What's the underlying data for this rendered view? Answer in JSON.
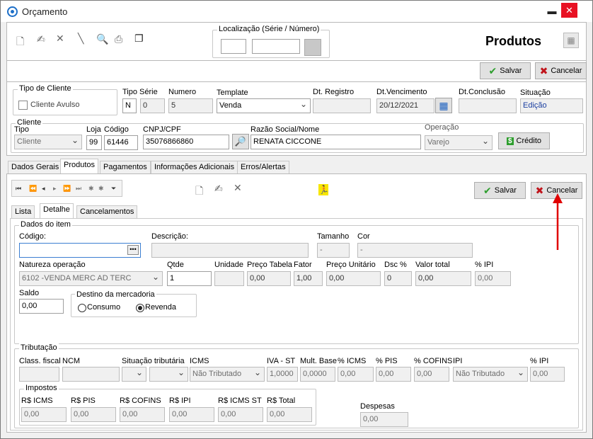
{
  "window": {
    "title": "Orçamento",
    "minimize": "▬",
    "maximize": "☐",
    "close": "✕"
  },
  "toolbar": {
    "localizacao_label": "Localização (Série / Número)",
    "section_title": "Produtos",
    "salvar": "Salvar",
    "cancelar": "Cancelar"
  },
  "header": {
    "tipo_cliente_label": "Tipo de Cliente",
    "cliente_avulso": "Cliente Avulso",
    "tipo_serie_label": "Tipo Série",
    "tipo_serie": "N",
    "serie": "0",
    "numero_label": "Numero",
    "numero": "5",
    "template_label": "Template",
    "template": "Venda",
    "dt_registro_label": "Dt. Registro",
    "dt_registro": "",
    "dt_vencimento_label": "Dt.Vencimento",
    "dt_vencimento": "20/12/2021",
    "dt_conclusao_label": "Dt.Conclusão",
    "dt_conclusao": "",
    "situacao_label": "Situação",
    "situacao": "Edição"
  },
  "cliente": {
    "group_label": "Cliente",
    "tipo_label": "Tipo",
    "tipo": "Cliente",
    "loja_label": "Loja",
    "loja": "99",
    "codigo_label": "Código",
    "codigo": "61446",
    "cnpj_label": "CNPJ/CPF",
    "cnpj": "35076866860",
    "razao_label": "Razão Social/Nome",
    "razao": "RENATA CICCONE",
    "operacao_label": "Operação",
    "operacao": "Varejo",
    "credito": "Crédito"
  },
  "tabs": [
    "Dados Gerais",
    "Produtos",
    "Pagamentos",
    "Informações Adicionais",
    "Erros/Alertas"
  ],
  "produtos_bar": {
    "salvar": "Salvar",
    "cancelar": "Cancelar"
  },
  "subtabs": [
    "Lista",
    "Detalhe",
    "Cancelamentos"
  ],
  "item": {
    "group_label": "Dados do item",
    "codigo_label": "Código:",
    "codigo": "",
    "descricao_label": "Descrição:",
    "descricao": "",
    "tamanho_label": "Tamanho",
    "tamanho": "-",
    "cor_label": "Cor",
    "cor": "-",
    "natureza_label": "Natureza operação",
    "natureza": "6102 -VENDA MERC AD TERC",
    "qtde_label": "Qtde",
    "qtde": "1",
    "unidade_label": "Unidade",
    "unidade": "",
    "preco_tabela_label": "Preço Tabela",
    "preco_tabela": "0,00",
    "fator_label": "Fator",
    "fator": "1,00",
    "preco_unit_label": "Preço Unitário",
    "preco_unit": "0,00",
    "dsc_label": "Dsc %",
    "dsc": "0",
    "valor_total_label": "Valor total",
    "valor_total": "0,00",
    "ipi_label": "% IPI",
    "ipi": "0,00",
    "saldo_label": "Saldo",
    "saldo": "0,00",
    "destino_label": "Destino da mercadoria",
    "consumo": "Consumo",
    "revenda": "Revenda"
  },
  "tributacao": {
    "group_label": "Tributação",
    "class_fiscal_label": "Class. fiscal",
    "ncm_label": "NCM",
    "sit_trib_label": "Situação tributária",
    "icms_label": "ICMS",
    "icms": "Não Tributado",
    "iva_label": "IVA - ST",
    "iva": "1,0000",
    "mult_label": "Mult. Base",
    "mult": "0,0000",
    "picms_label": "% ICMS",
    "picms": "0,00",
    "pis_label": "% PIS",
    "pis": "0,00",
    "cofins_label": "% COFINS",
    "cofins": "0,00",
    "ipi_label": "IPI",
    "ipi": "Não Tributado",
    "pipi_label": "% IPI",
    "pipi": "0,00"
  },
  "impostos": {
    "group_label": "Impostos",
    "r_icms_label": "R$ ICMS",
    "r_icms": "0,00",
    "r_pis_label": "R$ PIS",
    "r_pis": "0,00",
    "r_cofins_label": "R$ COFINS",
    "r_cofins": "0,00",
    "r_ipi_label": "R$ IPI",
    "r_ipi": "0,00",
    "r_icmsst_label": "R$ ICMS ST",
    "r_icmsst": "0,00",
    "r_total_label": "R$ Total",
    "r_total": "0,00",
    "despesas_label": "Despesas",
    "despesas": "0,00"
  },
  "colors": {
    "accent_red": "#e00000",
    "save_green": "#2e9e2e",
    "cancel_red": "#c0141b"
  }
}
